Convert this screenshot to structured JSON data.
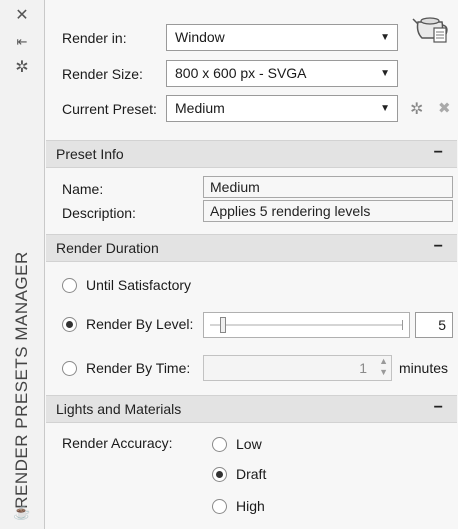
{
  "strip": {
    "vertical_title": "RENDER PRESETS MANAGER",
    "icons": [
      "close-icon",
      "pin-icon",
      "settings-icon",
      "teapot-icon"
    ]
  },
  "render_in": {
    "label": "Render in:",
    "value": "Window"
  },
  "render_size": {
    "label": "Render Size:",
    "value": "800 x 600 px - SVGA"
  },
  "current_preset": {
    "label": "Current Preset:",
    "value": "Medium"
  },
  "preset_info": {
    "header": "Preset Info",
    "collapse": "−",
    "name_label": "Name:",
    "name_value": "Medium",
    "description_label": "Description:",
    "description_value": "Applies 5 rendering levels"
  },
  "render_duration": {
    "header": "Render Duration",
    "collapse": "−",
    "until_satisfactory": "Until Satisfactory",
    "by_level_label": "Render By Level:",
    "level_value": "5",
    "level_fraction": 0.05,
    "by_time_label": "Render By Time:",
    "time_value": "1",
    "time_unit": "minutes",
    "selected": "Render By Level"
  },
  "lights_materials": {
    "header": "Lights and Materials",
    "collapse": "−",
    "accuracy_label": "Render Accuracy:",
    "options": [
      "Low",
      "Draft",
      "High"
    ],
    "selected": "Draft"
  }
}
